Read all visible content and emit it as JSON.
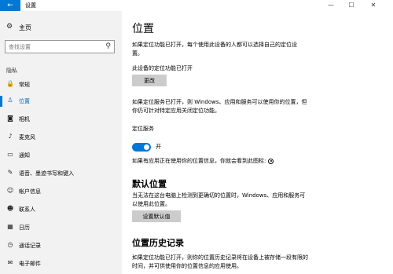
{
  "window": {
    "title": "设置",
    "back_glyph": "←",
    "minimize_glyph": "—",
    "maximize_glyph": "☐",
    "close_glyph": "✕"
  },
  "sidebar": {
    "home_label": "主页",
    "search_placeholder": "查找设置",
    "group_label": "隐私",
    "items": [
      {
        "label": "常规",
        "icon": "lock-icon",
        "glyph": "🔒"
      },
      {
        "label": "位置",
        "icon": "location-icon",
        "glyph": "♙"
      },
      {
        "label": "相机",
        "icon": "camera-icon",
        "glyph": "◙"
      },
      {
        "label": "麦克风",
        "icon": "microphone-icon",
        "glyph": "♪"
      },
      {
        "label": "通知",
        "icon": "notification-icon",
        "glyph": "▭"
      },
      {
        "label": "语音、墨迹书写和键入",
        "icon": "ink-icon",
        "glyph": "✎"
      },
      {
        "label": "帐户信息",
        "icon": "account-icon",
        "glyph": "☺"
      },
      {
        "label": "联系人",
        "icon": "contacts-icon",
        "glyph": "☻"
      },
      {
        "label": "日历",
        "icon": "calendar-icon",
        "glyph": "▦"
      },
      {
        "label": "通话记录",
        "icon": "call-history-icon",
        "glyph": "◷"
      },
      {
        "label": "电子邮件",
        "icon": "mail-icon",
        "glyph": "✉"
      }
    ],
    "active_index": 1
  },
  "main": {
    "title": "位置",
    "intro": "如果定位功能已打开，每个使用此设备的人都可以选择自己的定位设置。",
    "device_status": "此设备的定位功能已打开",
    "change_button": "更改",
    "service_desc": "如果定位服务已打开，则 Windows、应用和服务可以使用你的位置，但你仍可针对特定应用关闭定位功能。",
    "service_label": "定位服务",
    "toggle_state": "开",
    "toggle_on": true,
    "icon_note": "如果有应用正在使用你的位置信息，你就会看到此图标:",
    "default_title": "默认位置",
    "default_desc": "当无法在这台电脑上检测到更确切的位置时，Windows、应用和服务可以使用此位置。",
    "default_button": "设置默认值",
    "history_title": "位置历史记录",
    "history_desc": "如果定位功能已打开，则你的位置历史记录将在设备上被存储一段有限的时间，并可供使用你的位置信息的应用使用。"
  },
  "colors": {
    "accent": "#0078d7",
    "sidebar_bg": "#f2f2f2",
    "button_bg": "#cccccc"
  }
}
